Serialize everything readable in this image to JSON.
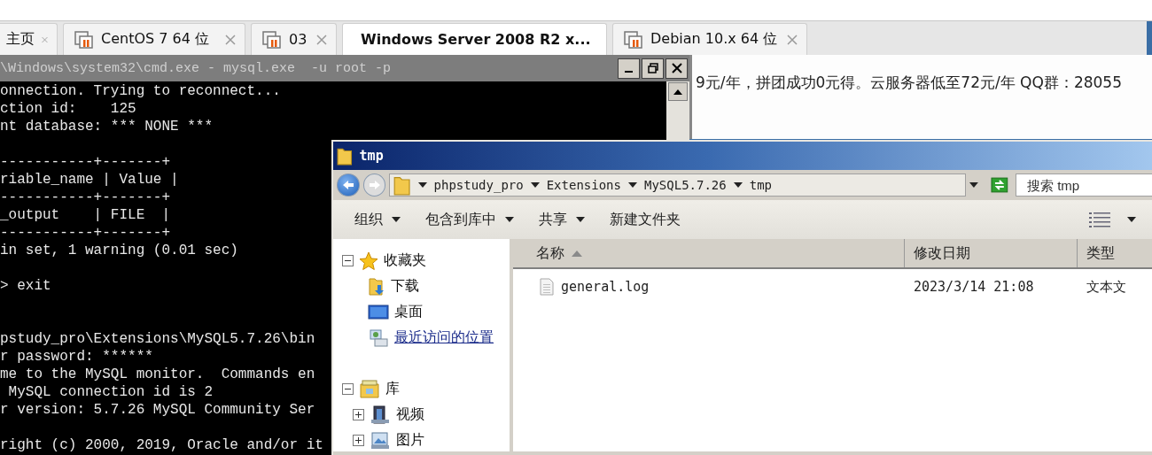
{
  "vm_tabs": [
    {
      "label": "主页",
      "kind": "home",
      "selected": false
    },
    {
      "label": "CentOS 7 64 位",
      "kind": "vm",
      "selected": false
    },
    {
      "label": "03",
      "kind": "vm",
      "selected": false
    },
    {
      "label": "Windows Server 2008 R2 x...",
      "kind": "running",
      "selected": true
    },
    {
      "label": "Debian 10.x 64 位",
      "kind": "vm",
      "selected": false
    }
  ],
  "cmd_window": {
    "title": "\\Windows\\system32\\cmd.exe - mysql.exe  -u root -p",
    "blocks": [
      {
        "wide_gap": false,
        "lines": [
          "onnection. Trying to reconnect...",
          "ction id:    125",
          "nt database: *** NONE ***"
        ]
      },
      {
        "wide_gap": false,
        "lines": [
          "-----------+-------+",
          "riable_name | Value |",
          "-----------+-------+",
          "_output    | FILE  |",
          "-----------+-------+",
          "in set, 1 warning (0.01 sec)"
        ]
      },
      {
        "wide_gap": true,
        "lines": [
          "> exit"
        ]
      },
      {
        "wide_gap": false,
        "lines": [
          "pstudy_pro\\Extensions\\MySQL5.7.26\\bin",
          "r password: ******",
          "me to the MySQL monitor.  Commands en",
          " MySQL connection id is 2",
          "r version: 5.7.26 MySQL Community Ser"
        ]
      },
      {
        "wide_gap": false,
        "lines": [
          "right (c) 2000, 2019, Oracle and/or it"
        ]
      }
    ]
  },
  "browser": {
    "banner": "9元/年，拼团成功0元得。云服务器低至72元/年  QQ群：28055"
  },
  "explorer": {
    "title": "tmp",
    "breadcrumb": [
      "phpstudy_pro",
      "Extensions",
      "MySQL5.7.26",
      "tmp"
    ],
    "search": {
      "placeholder": "搜索 tmp"
    },
    "toolbar": [
      {
        "label": "组织",
        "dropdown": true
      },
      {
        "label": "包含到库中",
        "dropdown": true
      },
      {
        "label": "共享",
        "dropdown": true
      },
      {
        "label": "新建文件夹",
        "dropdown": false
      }
    ],
    "nav": [
      {
        "label": "收藏夹",
        "kind": "star",
        "expanded": true,
        "children": [
          {
            "label": "下载",
            "kind": "download",
            "hovered": false
          },
          {
            "label": "桌面",
            "kind": "desktop",
            "hovered": false
          },
          {
            "label": "最近访问的位置",
            "kind": "recent",
            "hovered": true
          }
        ]
      },
      {
        "label": "库",
        "kind": "library",
        "expanded": true,
        "children": [
          {
            "label": "视频",
            "kind": "video",
            "expanded": false
          },
          {
            "label": "图片",
            "kind": "picture",
            "expanded": false
          }
        ]
      }
    ],
    "columns": [
      {
        "label": "名称",
        "sorted": true
      },
      {
        "label": "修改日期",
        "sorted": false
      },
      {
        "label": "类型",
        "sorted": false
      }
    ],
    "files": [
      {
        "name": "general.log",
        "modified": "2023/3/14 21:08",
        "type": "文本文"
      }
    ]
  }
}
